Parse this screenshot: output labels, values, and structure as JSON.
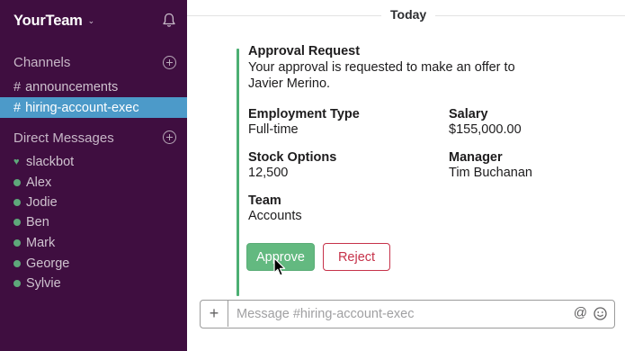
{
  "sidebar": {
    "team_name": "YourTeam",
    "channels_label": "Channels",
    "channels": [
      {
        "name": "announcements",
        "active": false
      },
      {
        "name": "hiring-account-exec",
        "active": true
      }
    ],
    "dm_label": "Direct Messages",
    "direct_messages": [
      "slackbot",
      "Alex",
      "Jodie",
      "Ben",
      "Mark",
      "George",
      "Sylvie"
    ]
  },
  "main": {
    "day_label": "Today",
    "card": {
      "title": "Approval Request",
      "text": "Your approval is requested to make an offer to Javier Merino.",
      "fields": [
        {
          "title": "Employment Type",
          "value": "Full-time"
        },
        {
          "title": "Salary",
          "value": "$155,000.00"
        },
        {
          "title": "Stock Options",
          "value": "12,500"
        },
        {
          "title": "Manager",
          "value": "Tim Buchanan"
        },
        {
          "title": "Team",
          "value": "Accounts"
        }
      ],
      "approve_label": "Approve",
      "reject_label": "Reject"
    },
    "composer": {
      "placeholder": "Message #hiring-account-exec",
      "plus": "+",
      "at": "@"
    }
  },
  "colors": {
    "sidebar_bg": "#3f0e40",
    "active_channel": "#4c9ac9",
    "presence_green": "#5ea87a",
    "approve_green": "#63b980",
    "reject_red": "#c6324a",
    "attachment_bar": "#4caf73"
  },
  "icons": {
    "team_menu": "chevron-down-icon",
    "notifications": "bell-icon",
    "add_channel": "plus-circle-icon",
    "add_dm": "plus-circle-icon",
    "slackbot": "heart-icon",
    "presence": "dot-icon",
    "attach": "plus-icon",
    "mention": "at-icon",
    "emoji": "smiley-icon",
    "pointer": "cursor-icon"
  }
}
